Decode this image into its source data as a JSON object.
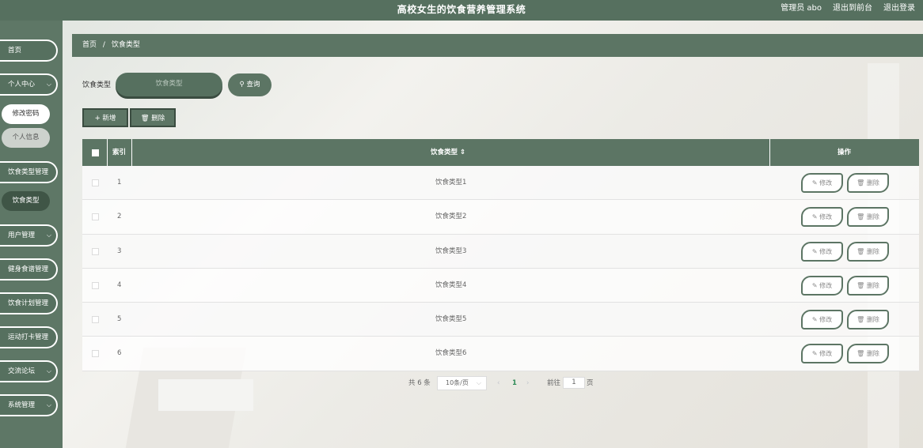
{
  "header": {
    "title": "高校女生的饮食营养管理系统",
    "admin": "管理员 abo",
    "back_front": "退出到前台",
    "logout": "退出登录"
  },
  "sidebar": {
    "items": [
      {
        "label": "首页"
      },
      {
        "label": "个人中心"
      },
      {
        "label": "修改密码"
      },
      {
        "label": "个人信息"
      },
      {
        "label": "饮食类型管理"
      },
      {
        "label": "饮食类型"
      },
      {
        "label": "用户管理"
      },
      {
        "label": "健身食谱管理"
      },
      {
        "label": "饮食计划管理"
      },
      {
        "label": "运动打卡管理"
      },
      {
        "label": "交流论坛"
      },
      {
        "label": "系统管理"
      }
    ],
    "chevron": "⌵"
  },
  "breadcrumb": {
    "home": "首页",
    "sep": "/",
    "current": "饮食类型"
  },
  "search": {
    "label": "饮食类型",
    "placeholder": "饮食类型",
    "button": "查询"
  },
  "actions": {
    "add": "新增",
    "delete": "删除"
  },
  "table": {
    "headers": {
      "index": "索引",
      "type": "饮食类型",
      "sort": "⇕",
      "ops": "操作"
    },
    "rows": [
      {
        "index": "1",
        "type": "饮食类型1"
      },
      {
        "index": "2",
        "type": "饮食类型2"
      },
      {
        "index": "3",
        "type": "饮食类型3"
      },
      {
        "index": "4",
        "type": "饮食类型4"
      },
      {
        "index": "5",
        "type": "饮食类型5"
      },
      {
        "index": "6",
        "type": "饮食类型6"
      }
    ],
    "edit_label": "修改",
    "delete_label": "删除"
  },
  "pagination": {
    "total": "共 6 条",
    "page_size": "10条/页",
    "current_page": "1",
    "goto_label": "前往",
    "goto_value": "1",
    "page_unit": "页"
  }
}
